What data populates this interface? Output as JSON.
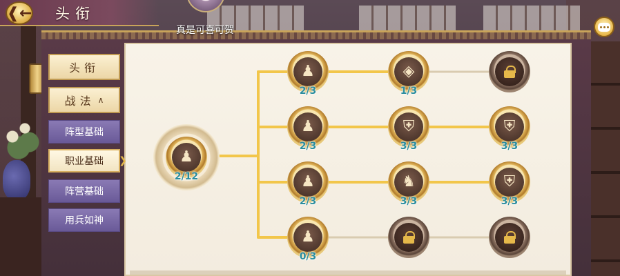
{
  "header": {
    "title": "头衔",
    "back_icon": "back-arrow-icon",
    "player_name": "真是可喜可贺"
  },
  "chat": {
    "icon": "chat-bubble-icon"
  },
  "side_menu": {
    "primary": [
      {
        "label": "头衔"
      },
      {
        "label": "战法",
        "caret": "^"
      }
    ],
    "sub": [
      {
        "label": "阵型基础",
        "active": false
      },
      {
        "label": "职业基础",
        "active": true
      },
      {
        "label": "阵营基础",
        "active": false
      },
      {
        "label": "用兵如神",
        "active": false
      }
    ]
  },
  "skill_tree": {
    "root": {
      "level": "2/12",
      "icon": "warrior-figure-icon"
    },
    "rows": [
      [
        {
          "level": "2/3",
          "icon": "warrior-figure-icon"
        },
        {
          "level": "1/3",
          "icon": "diamond-emblem-icon"
        },
        {
          "level": "",
          "icon": "lock-icon",
          "locked": true
        }
      ],
      [
        {
          "level": "2/3",
          "icon": "warrior-figure-icon"
        },
        {
          "level": "3/3",
          "icon": "shield-icon"
        },
        {
          "level": "3/3",
          "icon": "shield-icon"
        }
      ],
      [
        {
          "level": "2/3",
          "icon": "warrior-figure-icon"
        },
        {
          "level": "3/3",
          "icon": "dragon-icon"
        },
        {
          "level": "3/3",
          "icon": "shield-icon"
        }
      ],
      [
        {
          "level": "0/3",
          "icon": "warrior-figure-icon"
        },
        {
          "level": "",
          "icon": "lock-icon",
          "locked": true
        },
        {
          "level": "",
          "icon": "lock-icon",
          "locked": true
        }
      ]
    ]
  },
  "colors": {
    "accent_gold": "#e5b84a",
    "level_text": "#2a8d9e",
    "menu_purple": "#7a6aa8"
  }
}
